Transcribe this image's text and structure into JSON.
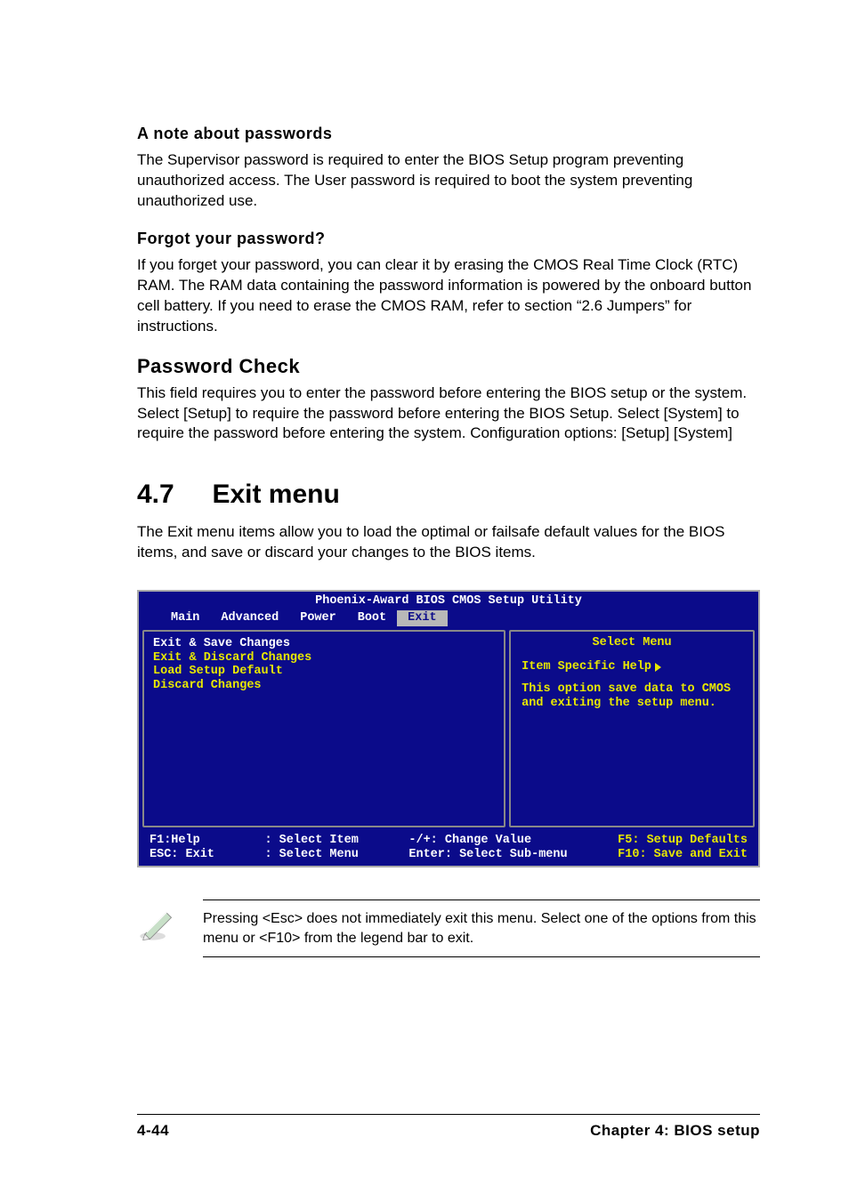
{
  "headings": {
    "note_passwords": "A note about passwords",
    "forgot": "Forgot your password?",
    "password_check": "Password Check"
  },
  "paragraphs": {
    "note_passwords": "The Supervisor password is required to enter the BIOS Setup program preventing unauthorized access. The User password is required to boot the system preventing unauthorized use.",
    "forgot": "If you forget your password, you can clear it by erasing the CMOS Real Time Clock (RTC) RAM. The RAM data containing the password information is powered by the onboard button cell battery. If you need to erase the CMOS RAM, refer to section “2.6 Jumpers” for instructions.",
    "password_check": "This field requires you to enter the password before entering the BIOS setup or the system. Select [Setup] to require the password before entering the BIOS Setup. Select [System] to require the password before entering the system. Configuration options: [Setup] [System]",
    "exit_menu": "The Exit menu items allow you to load the optimal or failsafe default values for the BIOS items, and save or discard your changes to the BIOS items."
  },
  "section": {
    "number": "4.7",
    "title": "Exit menu"
  },
  "bios": {
    "title": "Phoenix-Award BIOS CMOS Setup Utility",
    "tabs": [
      "Main",
      "Advanced",
      "Power",
      "Boot",
      "Exit"
    ],
    "active_tab": "Exit",
    "menu_items": [
      "Exit & Save Changes",
      "Exit & Discard Changes",
      "Load Setup Default",
      "Discard Changes"
    ],
    "selected_index": 0,
    "right_title": "Select Menu",
    "right_help_label": "Item Specific Help",
    "right_help_body": "This option save data to CMOS and exiting the setup menu.",
    "legend": {
      "col1": "F1:Help\nESC: Exit",
      "col2": ": Select Item\n: Select Menu",
      "col3": "-/+: Change Value\nEnter: Select Sub-menu",
      "col4": "F5: Setup Defaults\nF10: Save and Exit"
    }
  },
  "note": "Pressing <Esc> does not immediately exit this menu. Select one of the options from this menu or <F10> from the legend bar to exit.",
  "footer": {
    "left": "4-44",
    "right": "Chapter 4: BIOS setup"
  }
}
